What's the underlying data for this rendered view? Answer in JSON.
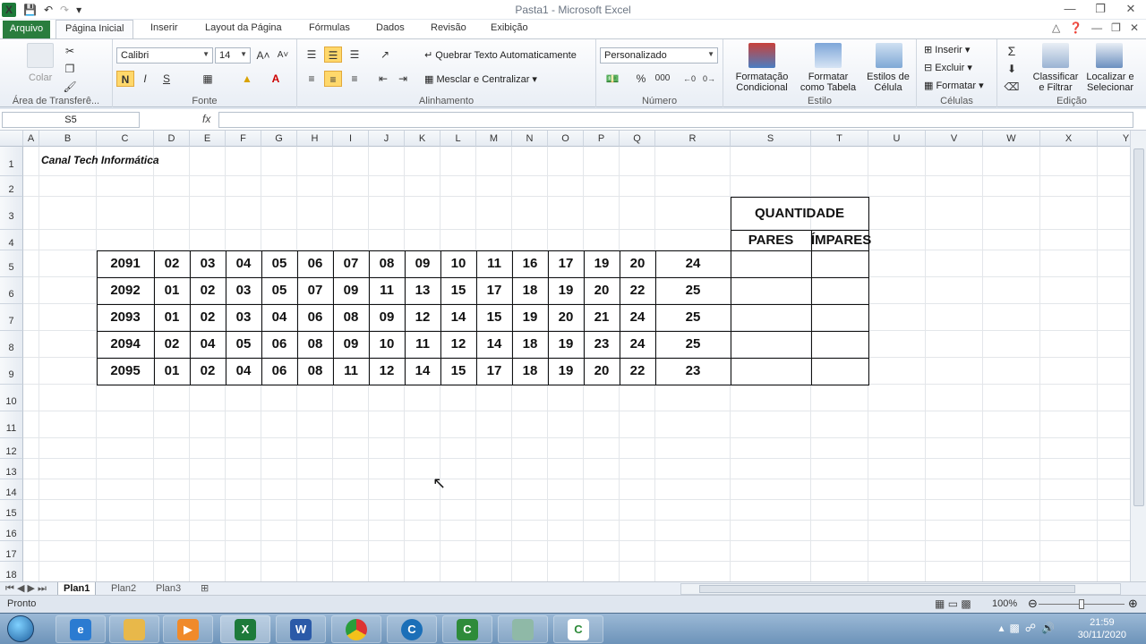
{
  "window": {
    "title": "Pasta1  -  Microsoft Excel"
  },
  "tabs": {
    "file": "Arquivo",
    "items": [
      "Página Inicial",
      "Inserir",
      "Layout da Página",
      "Fórmulas",
      "Dados",
      "Revisão",
      "Exibição"
    ]
  },
  "ribbon": {
    "clipboard": {
      "paste": "Colar",
      "label": "Área de Transferê..."
    },
    "font": {
      "name": "Calibri",
      "size": "14",
      "bold": "N",
      "italic": "I",
      "underline": "S",
      "label": "Fonte"
    },
    "alignment": {
      "wrap": "Quebrar Texto Automaticamente",
      "merge": "Mesclar e Centralizar",
      "label": "Alinhamento"
    },
    "number": {
      "format": "Personalizado",
      "percent": "%",
      "thousands": "000",
      "label": "Número"
    },
    "styles": {
      "conditional": [
        "Formatação",
        "Condicional"
      ],
      "table": [
        "Formatar",
        "como Tabela"
      ],
      "cell": [
        "Estilos de",
        "Célula"
      ],
      "label": "Estilo"
    },
    "cells": {
      "insert": "Inserir",
      "delete": "Excluir",
      "format": "Formatar",
      "label": "Células"
    },
    "editing": {
      "sort": [
        "Classificar",
        "e Filtrar"
      ],
      "find": [
        "Localizar e",
        "Selecionar"
      ],
      "sum": "Σ",
      "label": "Edição"
    }
  },
  "formula_bar": {
    "name_box": "S5",
    "fx": "fx",
    "value": ""
  },
  "columns": [
    "A",
    "B",
    "C",
    "D",
    "E",
    "F",
    "G",
    "H",
    "I",
    "J",
    "K",
    "L",
    "M",
    "N",
    "O",
    "P",
    "Q",
    "R",
    "S",
    "T",
    "U",
    "V",
    "W",
    "X",
    "Y"
  ],
  "rows": [
    "1",
    "2",
    "3",
    "4",
    "5",
    "6",
    "7",
    "8",
    "9",
    "10",
    "11",
    "12",
    "13",
    "14",
    "15",
    "16",
    "17",
    "18"
  ],
  "sheet": {
    "heading": "Canal Tech Informática",
    "header_main": "QUANTIDADE",
    "header_even": "PARES",
    "header_odd": "ÍMPARES",
    "data": [
      {
        "id": "2091",
        "nums": [
          "02",
          "03",
          "04",
          "05",
          "06",
          "07",
          "08",
          "09",
          "10",
          "11",
          "16",
          "17",
          "19",
          "20",
          "24"
        ]
      },
      {
        "id": "2092",
        "nums": [
          "01",
          "02",
          "03",
          "05",
          "07",
          "09",
          "11",
          "13",
          "15",
          "17",
          "18",
          "19",
          "20",
          "22",
          "25"
        ]
      },
      {
        "id": "2093",
        "nums": [
          "01",
          "02",
          "03",
          "04",
          "06",
          "08",
          "09",
          "12",
          "14",
          "15",
          "19",
          "20",
          "21",
          "24",
          "25"
        ]
      },
      {
        "id": "2094",
        "nums": [
          "02",
          "04",
          "05",
          "06",
          "08",
          "09",
          "10",
          "11",
          "12",
          "14",
          "18",
          "19",
          "23",
          "24",
          "25"
        ]
      },
      {
        "id": "2095",
        "nums": [
          "01",
          "02",
          "04",
          "06",
          "08",
          "11",
          "12",
          "14",
          "15",
          "17",
          "18",
          "19",
          "20",
          "22",
          "23"
        ]
      }
    ]
  },
  "sheet_tabs": [
    "Plan1",
    "Plan2",
    "Plan3"
  ],
  "status": {
    "ready": "Pronto",
    "zoom": "100%",
    "zoom_level_percent": 50
  },
  "taskbar": {
    "time": "21:59",
    "date": "30/11/2020"
  }
}
